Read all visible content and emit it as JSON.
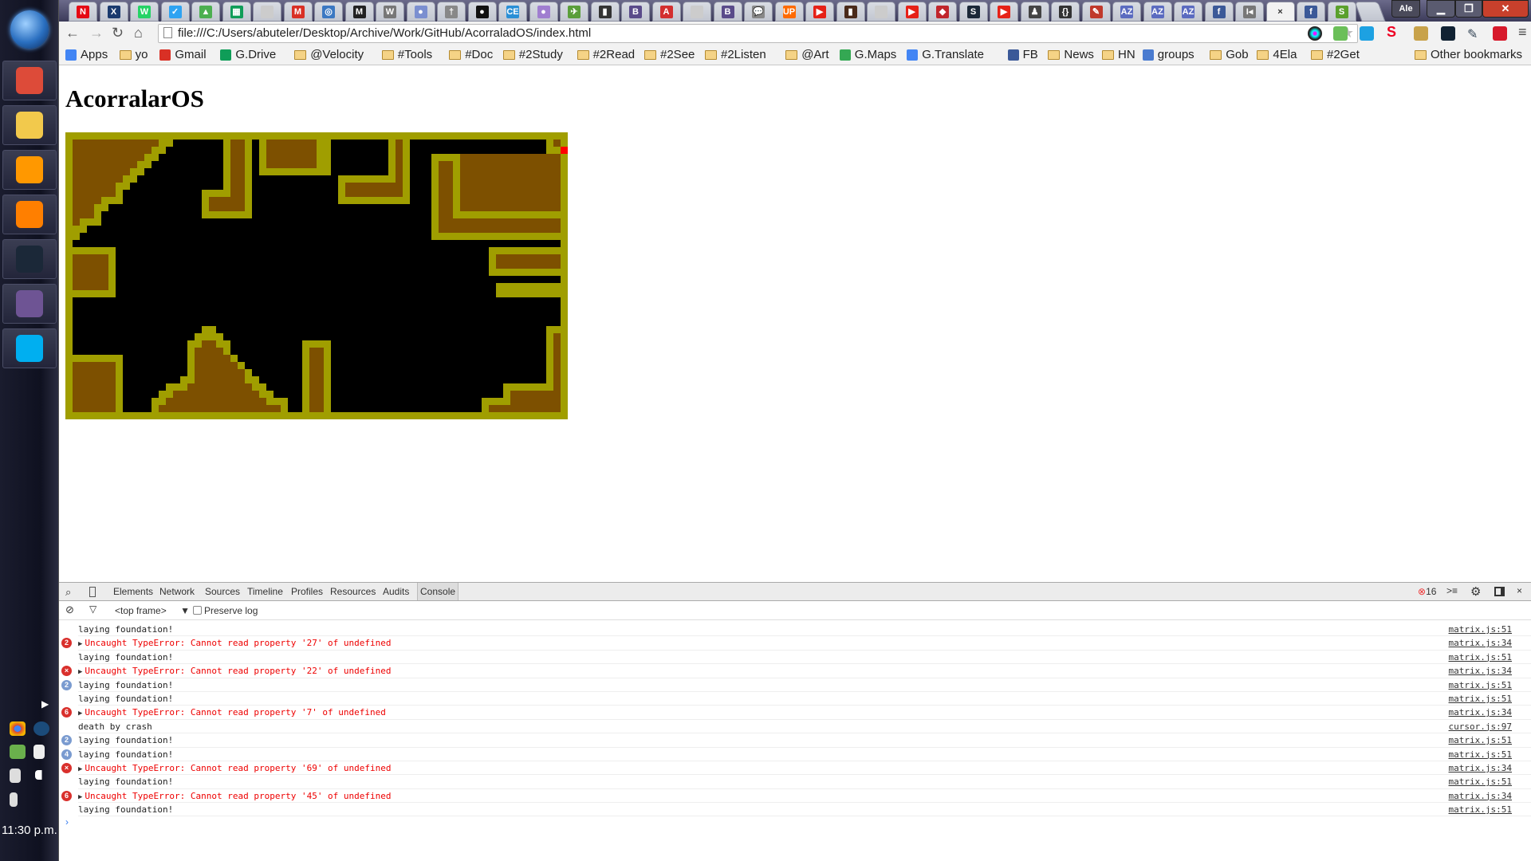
{
  "taskbar": {
    "apps": [
      {
        "name": "chrome",
        "color": "#dd4b39"
      },
      {
        "name": "file-explorer",
        "color": "#f2c94c"
      },
      {
        "name": "sublime-text",
        "color": "#ff9800"
      },
      {
        "name": "vlc",
        "color": "#ff7f00"
      },
      {
        "name": "steam",
        "color": "#1b2838"
      },
      {
        "name": "github",
        "color": "#6e5494"
      },
      {
        "name": "skype",
        "color": "#00aff0"
      }
    ],
    "clock": "11:30 p.m."
  },
  "browser": {
    "tabs": [
      {
        "icon": "N",
        "color": "#e50914"
      },
      {
        "icon": "X",
        "color": "#1a3a6e"
      },
      {
        "icon": "W",
        "color": "#25d366"
      },
      {
        "icon": "✓",
        "color": "#2ea3f2"
      },
      {
        "icon": "▲",
        "color": "#4caf50"
      },
      {
        "icon": "▦",
        "color": "#0f9d58"
      },
      {
        "icon": "",
        "color": "#cccccc"
      },
      {
        "icon": "M",
        "color": "#d93025"
      },
      {
        "icon": "◎",
        "color": "#3b78c2"
      },
      {
        "icon": "M",
        "color": "#222222"
      },
      {
        "icon": "W",
        "color": "#777777"
      },
      {
        "icon": "●",
        "color": "#7b8fd0"
      },
      {
        "icon": "†",
        "color": "#888888"
      },
      {
        "icon": "●",
        "color": "#111111"
      },
      {
        "icon": "CE",
        "color": "#2a8fd6"
      },
      {
        "icon": "●",
        "color": "#a07ed0"
      },
      {
        "icon": "✈",
        "color": "#5a9e3a"
      },
      {
        "icon": "▮",
        "color": "#333333"
      },
      {
        "icon": "B",
        "color": "#5a4b8a"
      },
      {
        "icon": "A",
        "color": "#d32f2f"
      },
      {
        "icon": "",
        "color": "#cccccc"
      },
      {
        "icon": "B",
        "color": "#5a4b8a"
      },
      {
        "icon": "💬",
        "color": "#888888"
      },
      {
        "icon": "UP",
        "color": "#ff6a00"
      },
      {
        "icon": "▶",
        "color": "#e62117"
      },
      {
        "icon": "▮",
        "color": "#4a2a1a"
      },
      {
        "icon": "",
        "color": "#cccccc"
      },
      {
        "icon": "▶",
        "color": "#e62117"
      },
      {
        "icon": "◆",
        "color": "#c0262c"
      },
      {
        "icon": "S",
        "color": "#1b2838"
      },
      {
        "icon": "▶",
        "color": "#e62117"
      },
      {
        "icon": "♟",
        "color": "#444444"
      },
      {
        "icon": "{}",
        "color": "#333333"
      },
      {
        "icon": "✎",
        "color": "#c0392b"
      },
      {
        "icon": "AZ",
        "color": "#5b6bc0"
      },
      {
        "icon": "AZ",
        "color": "#5b6bc0"
      },
      {
        "icon": "AZ",
        "color": "#5b6bc0"
      },
      {
        "icon": "f",
        "color": "#3b5998"
      },
      {
        "icon": "I◂",
        "color": "#777777"
      },
      {
        "icon": "×",
        "color": "#f2f2f2",
        "active": true
      },
      {
        "icon": "f",
        "color": "#3b5998"
      },
      {
        "icon": "S",
        "color": "#5aa02c"
      }
    ],
    "profile": "Ale",
    "url": "file:///C:/Users/abuteler/Desktop/Archive/Work/GitHub/AcorraladOS/index.html",
    "bookmarks": [
      {
        "label": "Apps",
        "icon": "apps-icon"
      },
      {
        "label": "yo",
        "icon": "folder"
      },
      {
        "label": "Gmail",
        "icon": "gmail-icon"
      },
      {
        "label": "G.Drive",
        "icon": "drive-icon"
      },
      {
        "label": "@Velocity",
        "icon": "folder"
      },
      {
        "label": "#Tools",
        "icon": "folder"
      },
      {
        "label": "#Doc",
        "icon": "folder"
      },
      {
        "label": "#2Study",
        "icon": "folder"
      },
      {
        "label": "#2Read",
        "icon": "folder"
      },
      {
        "label": "#2See",
        "icon": "folder"
      },
      {
        "label": "#2Listen",
        "icon": "folder"
      },
      {
        "label": "@Art",
        "icon": "folder"
      },
      {
        "label": "G.Maps",
        "icon": "maps-icon"
      },
      {
        "label": "G.Translate",
        "icon": "translate-icon"
      },
      {
        "label": "FB",
        "icon": "facebook-icon"
      },
      {
        "label": "News",
        "icon": "folder"
      },
      {
        "label": "HN",
        "icon": "folder"
      },
      {
        "label": "groups",
        "icon": "groups-icon"
      },
      {
        "label": "Gob",
        "icon": "folder"
      },
      {
        "label": "4Ela",
        "icon": "folder"
      },
      {
        "label": "#2Get",
        "icon": "folder"
      }
    ],
    "other_bookmarks": "Other bookmarks"
  },
  "page": {
    "title": "AcorralarOS",
    "game_colors": {
      "background": "#000000",
      "wall": "#a09e00",
      "ground": "#7d5000",
      "player": "#ff0000"
    }
  },
  "devtools": {
    "tabs": [
      "Elements",
      "Network",
      "Sources",
      "Timeline",
      "Profiles",
      "Resources",
      "Audits",
      "Console"
    ],
    "active_tab": "Console",
    "error_count": "16",
    "frame": "<top frame>",
    "preserve_log": "Preserve log",
    "preserve_log_checked": false,
    "messages": [
      {
        "type": "log",
        "count": "",
        "text": "laying foundation!",
        "source": "matrix.js:51"
      },
      {
        "type": "error",
        "count": "2",
        "text": "Uncaught TypeError: Cannot read property '27' of undefined",
        "source": "matrix.js:34"
      },
      {
        "type": "log",
        "count": "",
        "text": "laying foundation!",
        "source": "matrix.js:51"
      },
      {
        "type": "error",
        "count": "×",
        "text": "Uncaught TypeError: Cannot read property '22' of undefined",
        "source": "matrix.js:34"
      },
      {
        "type": "log",
        "count": "2",
        "text": "laying foundation!",
        "source": "matrix.js:51"
      },
      {
        "type": "log",
        "count": "",
        "text": "laying foundation!",
        "source": "matrix.js:51"
      },
      {
        "type": "error",
        "count": "6",
        "text": "Uncaught TypeError: Cannot read property '7' of undefined",
        "source": "matrix.js:34"
      },
      {
        "type": "log",
        "count": "",
        "text": "death by crash",
        "source": "cursor.js:97"
      },
      {
        "type": "log",
        "count": "2",
        "text": "laying foundation!",
        "source": "matrix.js:51"
      },
      {
        "type": "log",
        "count": "4",
        "text": "laying foundation!",
        "source": "matrix.js:51"
      },
      {
        "type": "error",
        "count": "×",
        "text": "Uncaught TypeError: Cannot read property '69' of undefined",
        "source": "matrix.js:34"
      },
      {
        "type": "log",
        "count": "",
        "text": "laying foundation!",
        "source": "matrix.js:51"
      },
      {
        "type": "error",
        "count": "6",
        "text": "Uncaught TypeError: Cannot read property '45' of undefined",
        "source": "matrix.js:34"
      },
      {
        "type": "log",
        "count": "",
        "text": "laying foundation!",
        "source": "matrix.js:51"
      }
    ],
    "prompt": "›"
  }
}
